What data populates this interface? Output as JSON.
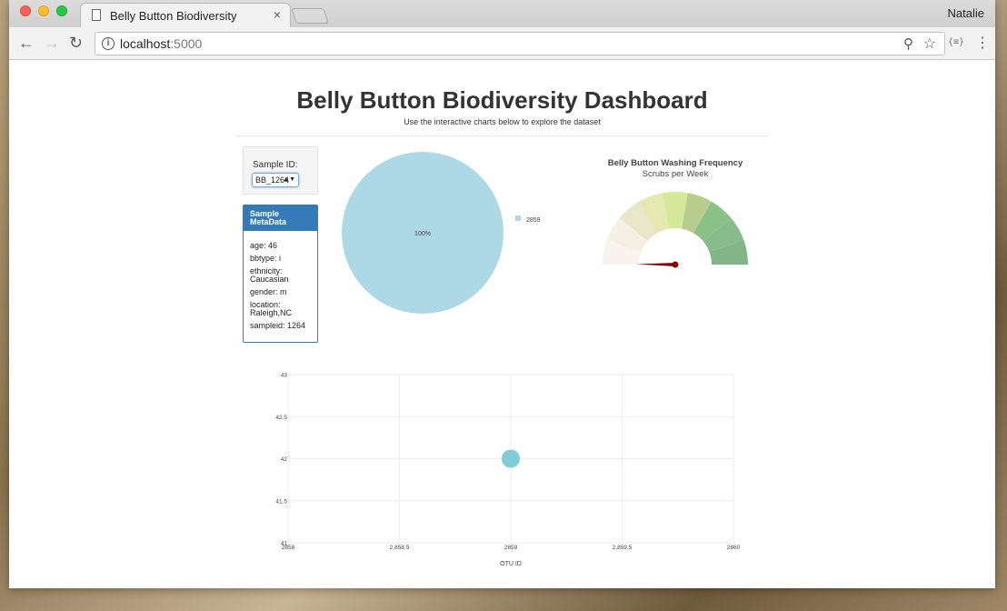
{
  "browser": {
    "tab_title": "Belly Button Biodiversity",
    "tab_close": "×",
    "profile_name": "Natalie",
    "url_host": "localhost",
    "url_port": ":5000",
    "ext_label": "{≡}"
  },
  "page": {
    "title": "Belly Button Biodiversity Dashboard",
    "subtitle": "Use the interactive charts below to explore the dataset"
  },
  "selector": {
    "label": "Sample ID:",
    "selected": "BB_1264"
  },
  "metadata": {
    "heading": "Sample MetaData",
    "rows": [
      "age: 46",
      "bbtype: i",
      "ethnicity: Caucasian",
      "gender: m",
      "location: Raleigh,NC",
      "sampleid: 1264"
    ]
  },
  "colors": {
    "pie": "#add8e6",
    "bubble": "#7fcdd9",
    "meta_header": "#337ab7",
    "needle": "#850000"
  },
  "chart_data": [
    {
      "type": "pie",
      "labels": [
        "2859"
      ],
      "values": [
        100
      ],
      "slice_label": "100%",
      "legend": [
        "2859"
      ]
    },
    {
      "type": "gauge",
      "title": "Belly Button Washing Frequency",
      "subtitle": "Scrubs per Week",
      "segments": 9,
      "segment_colors": [
        "#f8f3ec",
        "#f4f1e4",
        "#e9e6c9",
        "#e5e8b0",
        "#d5e99b",
        "#b7cd8f",
        "#8bc086",
        "#89bc8d",
        "#84b589"
      ],
      "value": 0
    },
    {
      "type": "scatter",
      "mode": "bubble",
      "x": [
        2859
      ],
      "y": [
        42
      ],
      "xlabel": "OTU ID",
      "xlim": [
        2858,
        2860
      ],
      "ylim": [
        41,
        43
      ],
      "xticks": [
        "2858",
        "2,858.5",
        "2859",
        "2,859.5",
        "2860"
      ],
      "yticks": [
        "41",
        "41.5",
        "42",
        "42.5",
        "43"
      ],
      "grid": true
    }
  ]
}
